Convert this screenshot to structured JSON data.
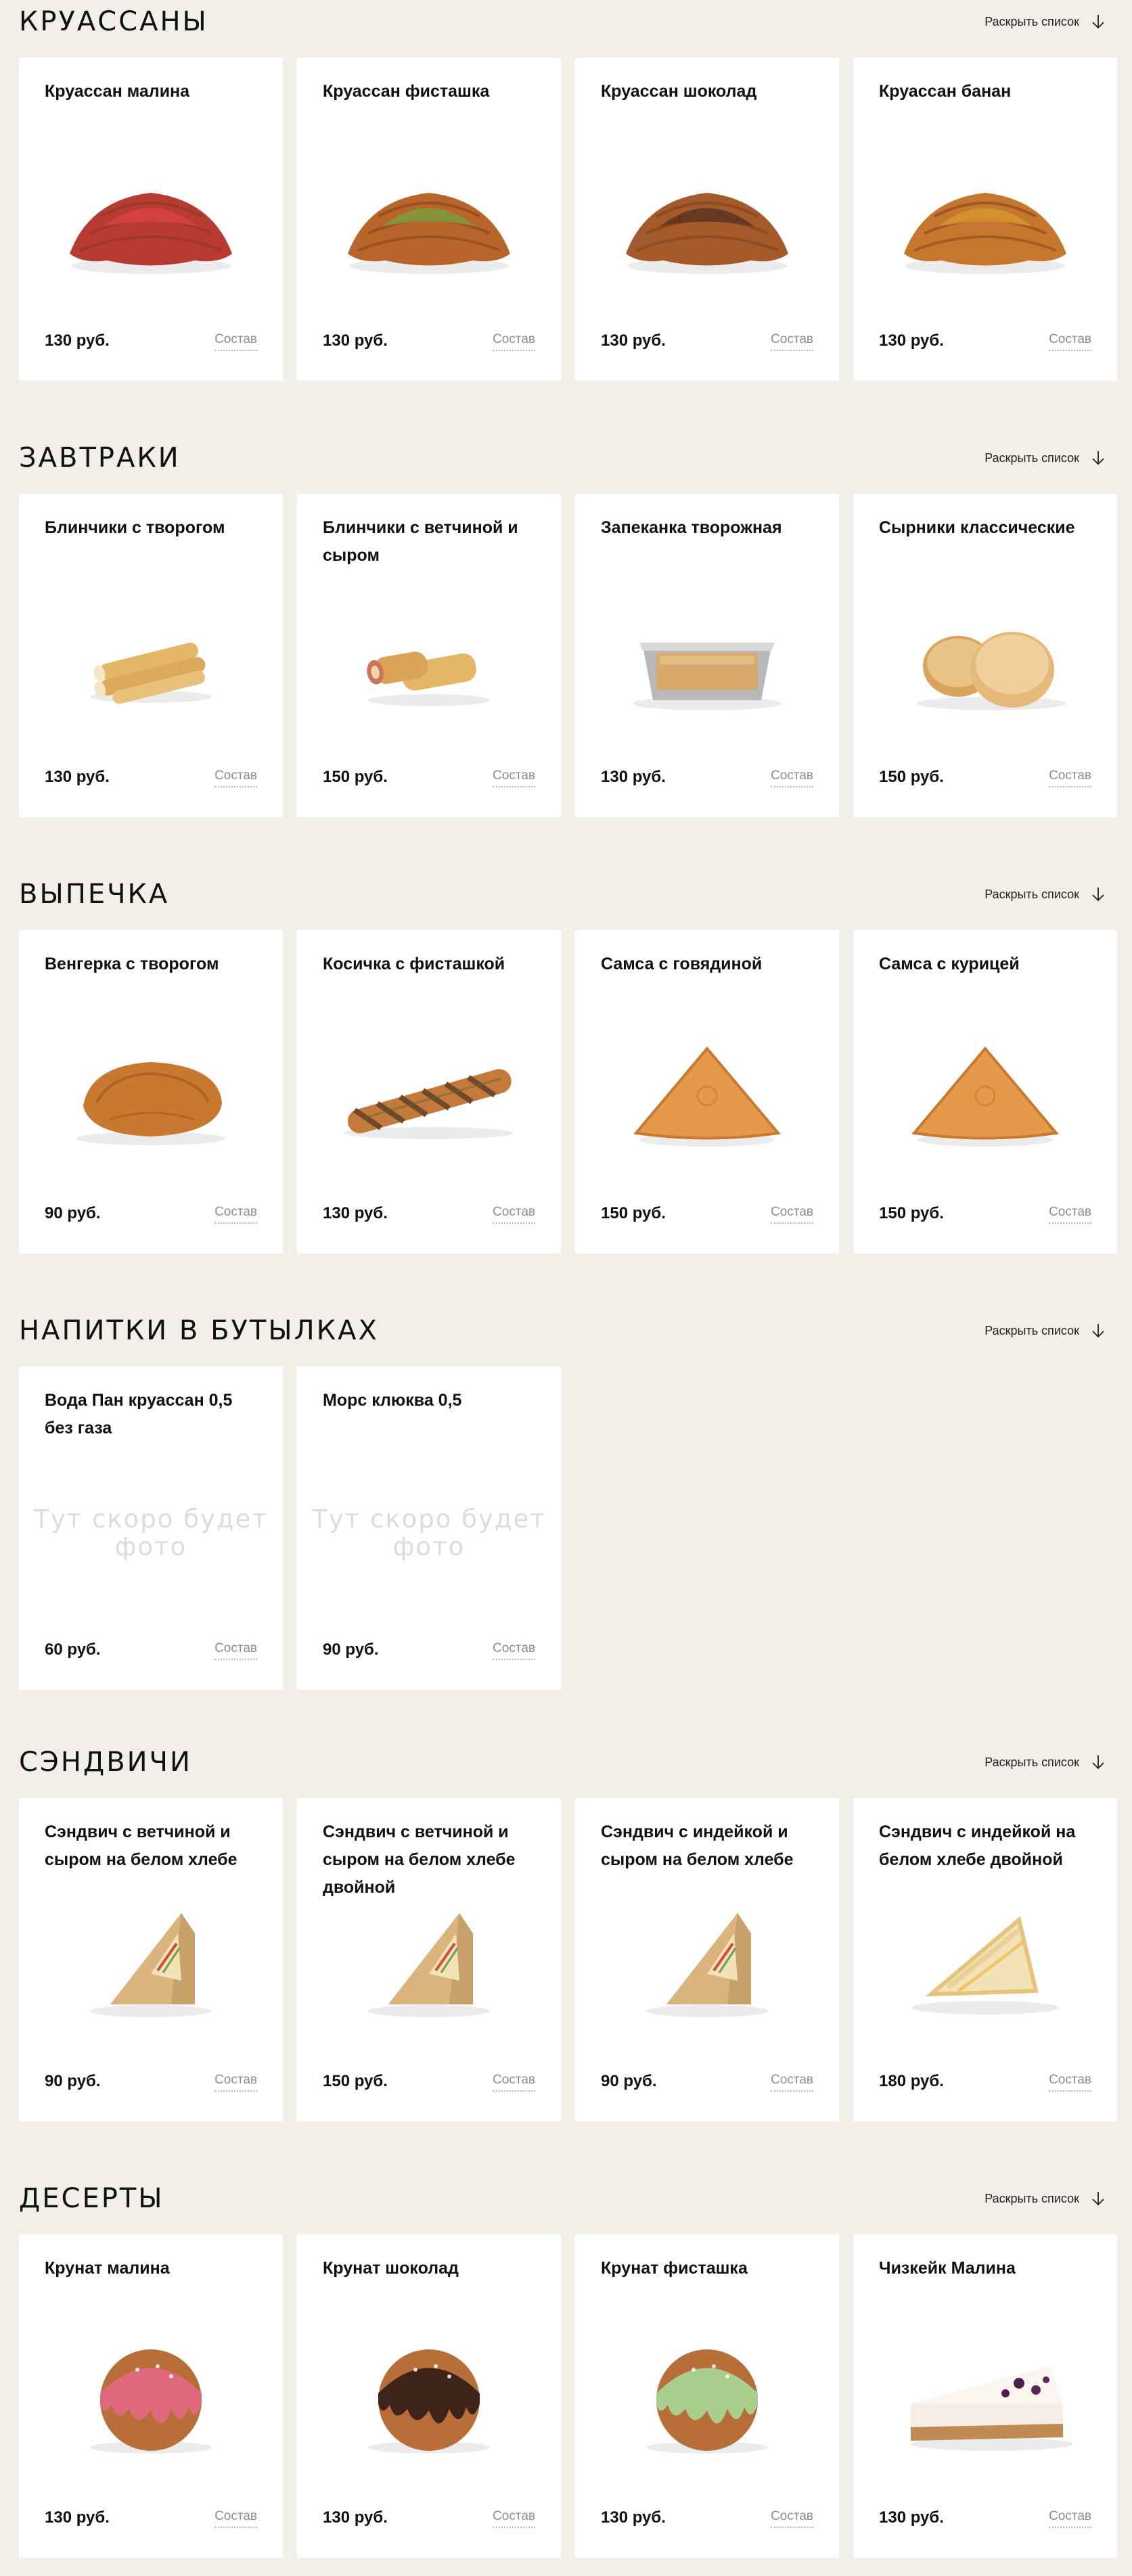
{
  "sections": [
    {
      "title": "КРУАССАНЫ",
      "expand_label": "Раскрыть список",
      "items": [
        {
          "name": "Круассан малина",
          "price": "130 руб.",
          "composition": "Состав",
          "image": "croissant-raspberry",
          "color": "#b83a32",
          "topping": "#d9433f"
        },
        {
          "name": "Круассан фисташка",
          "price": "130 руб.",
          "composition": "Состав",
          "image": "croissant-pistachio",
          "color": "#b8652c",
          "topping": "#7f9a3a"
        },
        {
          "name": "Круассан шоколад",
          "price": "130 руб.",
          "composition": "Состав",
          "image": "croissant-chocolate",
          "color": "#a45a2a",
          "topping": "#5e3520"
        },
        {
          "name": "Круассан банан",
          "price": "130 руб.",
          "composition": "Состав",
          "image": "croissant-banana",
          "color": "#c5772e",
          "topping": "#d6932e"
        }
      ]
    },
    {
      "title": "ЗАВТРАКИ",
      "expand_label": "Раскрыть список",
      "items": [
        {
          "name": "Блинчики с творогом",
          "price": "130 руб.",
          "composition": "Состав",
          "image": "pancakes-cottage-cheese"
        },
        {
          "name": "Блинчики с ветчиной и сыром",
          "price": "150 руб.",
          "composition": "Состав",
          "image": "pancakes-ham-cheese"
        },
        {
          "name": "Запеканка творожная",
          "price": "130 руб.",
          "composition": "Состав",
          "image": "cottage-cheese-casserole"
        },
        {
          "name": "Сырники классические",
          "price": "150 руб.",
          "composition": "Состав",
          "image": "syrniki"
        }
      ]
    },
    {
      "title": "ВЫПЕЧКА",
      "expand_label": "Раскрыть список",
      "items": [
        {
          "name": "Венгерка с творогом",
          "price": "90 руб.",
          "composition": "Состав",
          "image": "vengerka-pastry"
        },
        {
          "name": "Косичка с фисташкой",
          "price": "130 руб.",
          "composition": "Состав",
          "image": "pistachio-braid"
        },
        {
          "name": "Самса с говядиной",
          "price": "150 руб.",
          "composition": "Состав",
          "image": "samsa-beef"
        },
        {
          "name": "Самса с курицей",
          "price": "150 руб.",
          "composition": "Состав",
          "image": "samsa-chicken"
        }
      ]
    },
    {
      "title": "НАПИТКИ В БУТЫЛКАХ",
      "expand_label": "Раскрыть список",
      "items": [
        {
          "name": "Вода Пан круассан 0,5 без газа",
          "price": "60 руб.",
          "composition": "Состав",
          "placeholder": "Тут скоро будет фото"
        },
        {
          "name": "Морс клюква 0,5",
          "price": "90 руб.",
          "composition": "Состав",
          "placeholder": "Тут скоро будет фото"
        }
      ]
    },
    {
      "title": "СЭНДВИЧИ",
      "expand_label": "Раскрыть список",
      "items": [
        {
          "name": "Сэндвич с ветчиной и сыром на белом хлебе",
          "price": "90 руб.",
          "composition": "Состав",
          "image": "sandwich-box"
        },
        {
          "name": "Сэндвич с ветчиной и сыром на белом хлебе двойной",
          "price": "150 руб.",
          "composition": "Состав",
          "image": "sandwich-box-double"
        },
        {
          "name": "Сэндвич с индейкой и сыром на белом хлебе",
          "price": "90 руб.",
          "composition": "Состав",
          "image": "sandwich-box"
        },
        {
          "name": "Сэндвич с индейкой на белом хлебе двойной",
          "price": "180 руб.",
          "composition": "Состав",
          "image": "sandwich-open"
        }
      ]
    },
    {
      "title": "ДЕСЕРТЫ",
      "expand_label": "Раскрыть список",
      "items": [
        {
          "name": "Крунат малина",
          "price": "130 руб.",
          "composition": "Состав",
          "image": "crunat",
          "glaze": "#e06a7c"
        },
        {
          "name": "Крунат шоколад",
          "price": "130 руб.",
          "composition": "Состав",
          "image": "crunat",
          "glaze": "#3e2418"
        },
        {
          "name": "Крунат фисташка",
          "price": "130 руб.",
          "composition": "Состав",
          "image": "crunat",
          "glaze": "#a9cf8d"
        },
        {
          "name": "Чизкейк Малина",
          "price": "130 руб.",
          "composition": "Состав",
          "image": "cheesecake"
        }
      ]
    }
  ]
}
